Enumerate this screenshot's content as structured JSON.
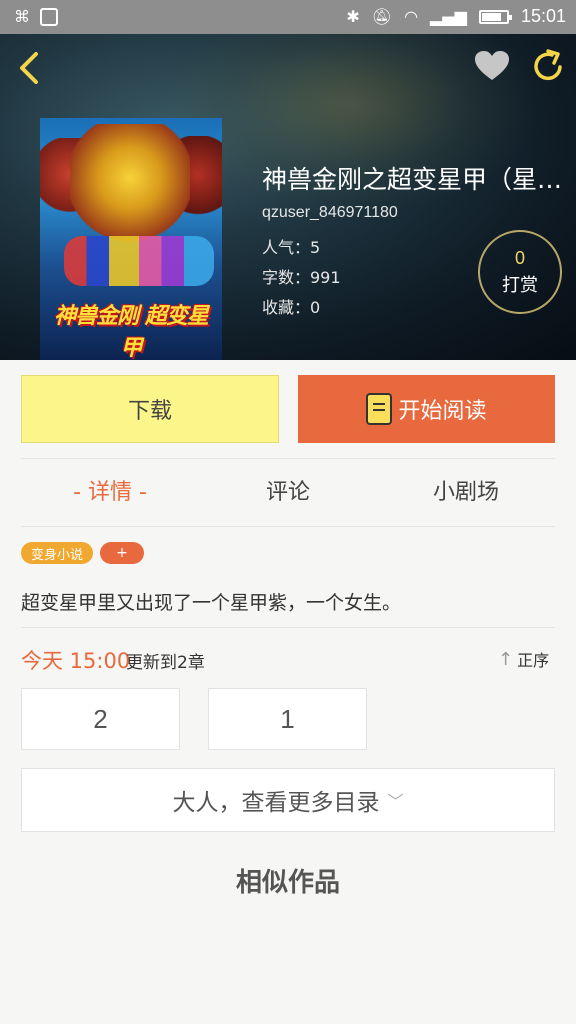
{
  "status_bar": {
    "time": "15:01"
  },
  "book": {
    "title": "神兽金刚之超变星甲（星…",
    "author": "qzuser_846971180",
    "popularity": "人气：5",
    "word_count": "字数：991",
    "favorites": "收藏：0",
    "cover_logo": "神兽金刚 超变星甲"
  },
  "tip": {
    "count": "0",
    "label": "打赏"
  },
  "actions": {
    "download": "下载",
    "read": "开始阅读"
  },
  "tabs": [
    {
      "label": "- 详情 -",
      "active": true
    },
    {
      "label": "评论",
      "active": false
    },
    {
      "label": "小剧场",
      "active": false
    }
  ],
  "tags": [
    {
      "label": "变身小说"
    },
    {
      "label": "+"
    }
  ],
  "description": "超变星甲里又出现了一个星甲紫，一个女生。",
  "update": {
    "time": "今天 15:00",
    "text": "更新到2章",
    "sort_label": "正序"
  },
  "chapters": [
    "2",
    "1"
  ],
  "more_catalog": "大人，查看更多目录",
  "similar_title": "相似作品",
  "colors": {
    "accent": "#e8693d",
    "download_bg": "#fbf58a",
    "tag_yellow": "#f0a830",
    "gold": "#f0d566"
  }
}
